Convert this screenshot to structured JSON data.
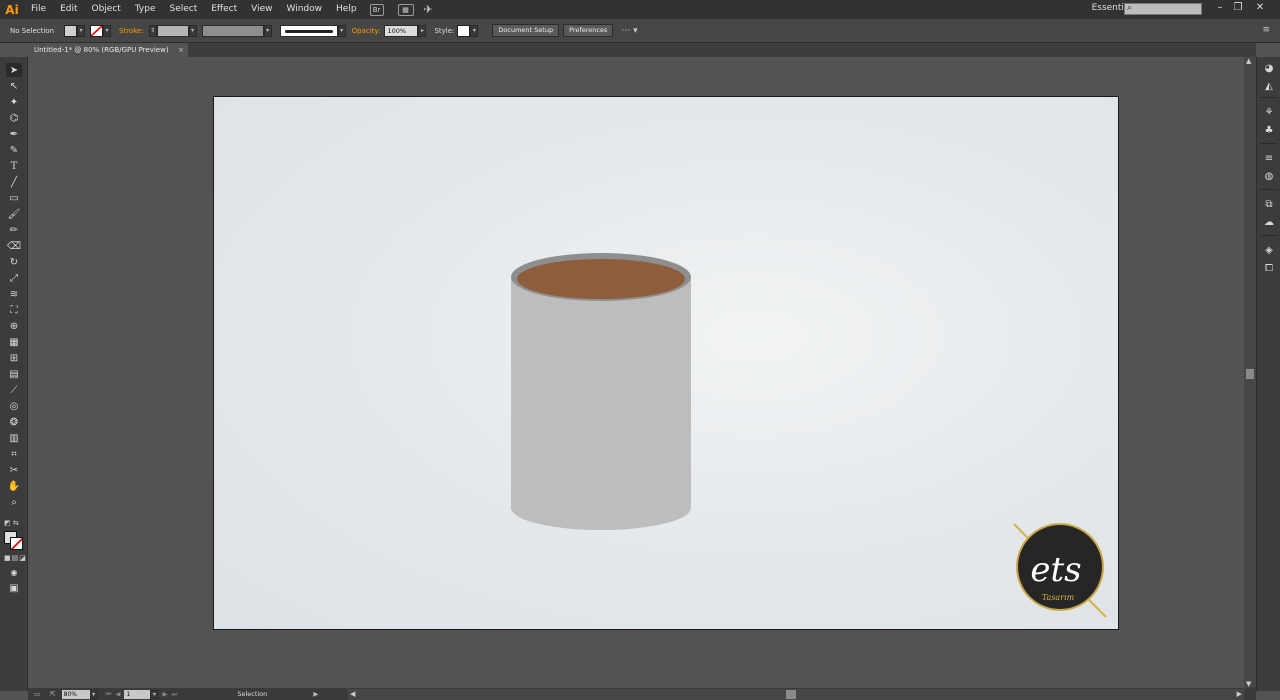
{
  "app": {
    "logo_text": "Ai",
    "menus": [
      "File",
      "Edit",
      "Object",
      "Type",
      "Select",
      "Effect",
      "View",
      "Window",
      "Help"
    ],
    "bridge_label": "Br",
    "workspace": "Essentials"
  },
  "control": {
    "selection": "No Selection",
    "stroke_label": "Stroke:",
    "opacity_label": "Opacity:",
    "opacity_value": "100%",
    "style_label": "Style:",
    "document_setup": "Document Setup",
    "preferences": "Preferences"
  },
  "tab": {
    "title": "Untitled-1* @ 80% (RGB/GPU Preview)",
    "close": "×"
  },
  "status": {
    "zoom": "80%",
    "page": "1",
    "tool": "Selection"
  },
  "logo": {
    "main_text": "ets",
    "sub_text": "Tasarım"
  },
  "colors": {
    "accent": "#ff9a00",
    "cup_body": "#bdbdbd",
    "cup_rim": "#8e8e8e",
    "coffee": "#8e5d3c",
    "logo_bg": "#262626",
    "logo_gold": "#d4b24a"
  }
}
